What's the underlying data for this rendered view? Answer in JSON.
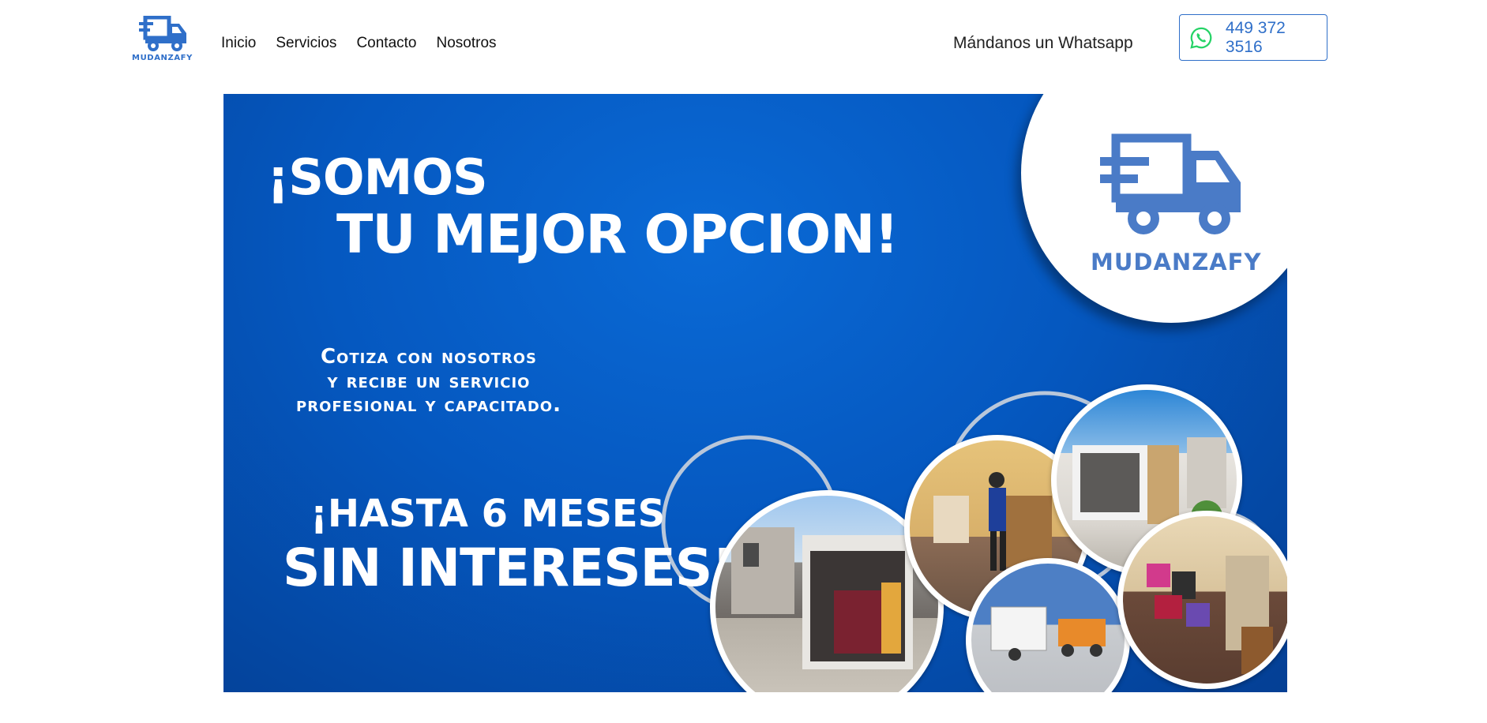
{
  "header": {
    "logo_text": "MUDANZAFY",
    "nav": [
      {
        "label": "Inicio"
      },
      {
        "label": "Servicios"
      },
      {
        "label": "Contacto"
      },
      {
        "label": "Nosotros"
      }
    ],
    "whatsapp_text": "Mándanos un Whatsapp",
    "whatsapp_number": "449 372 3516"
  },
  "banner": {
    "headline_line1": "¡SOMOS",
    "headline_line2": "TU MEJOR OPCION!",
    "sub_line1": "Cotiza con nosotros",
    "sub_line2": "y recibe un servicio",
    "sub_line3": "profesional y capacitado.",
    "promo_line1": "¡HASTA 6 MESES",
    "promo_line2": "SIN INTERESES!",
    "brand_name": "MUDANZAFY"
  },
  "colors": {
    "brand_blue": "#2f6fc9",
    "banner_blue": "#0558c0",
    "whatsapp_green": "#25d366"
  },
  "icons": {
    "logo": "truck-icon",
    "whatsapp": "whatsapp-icon"
  }
}
